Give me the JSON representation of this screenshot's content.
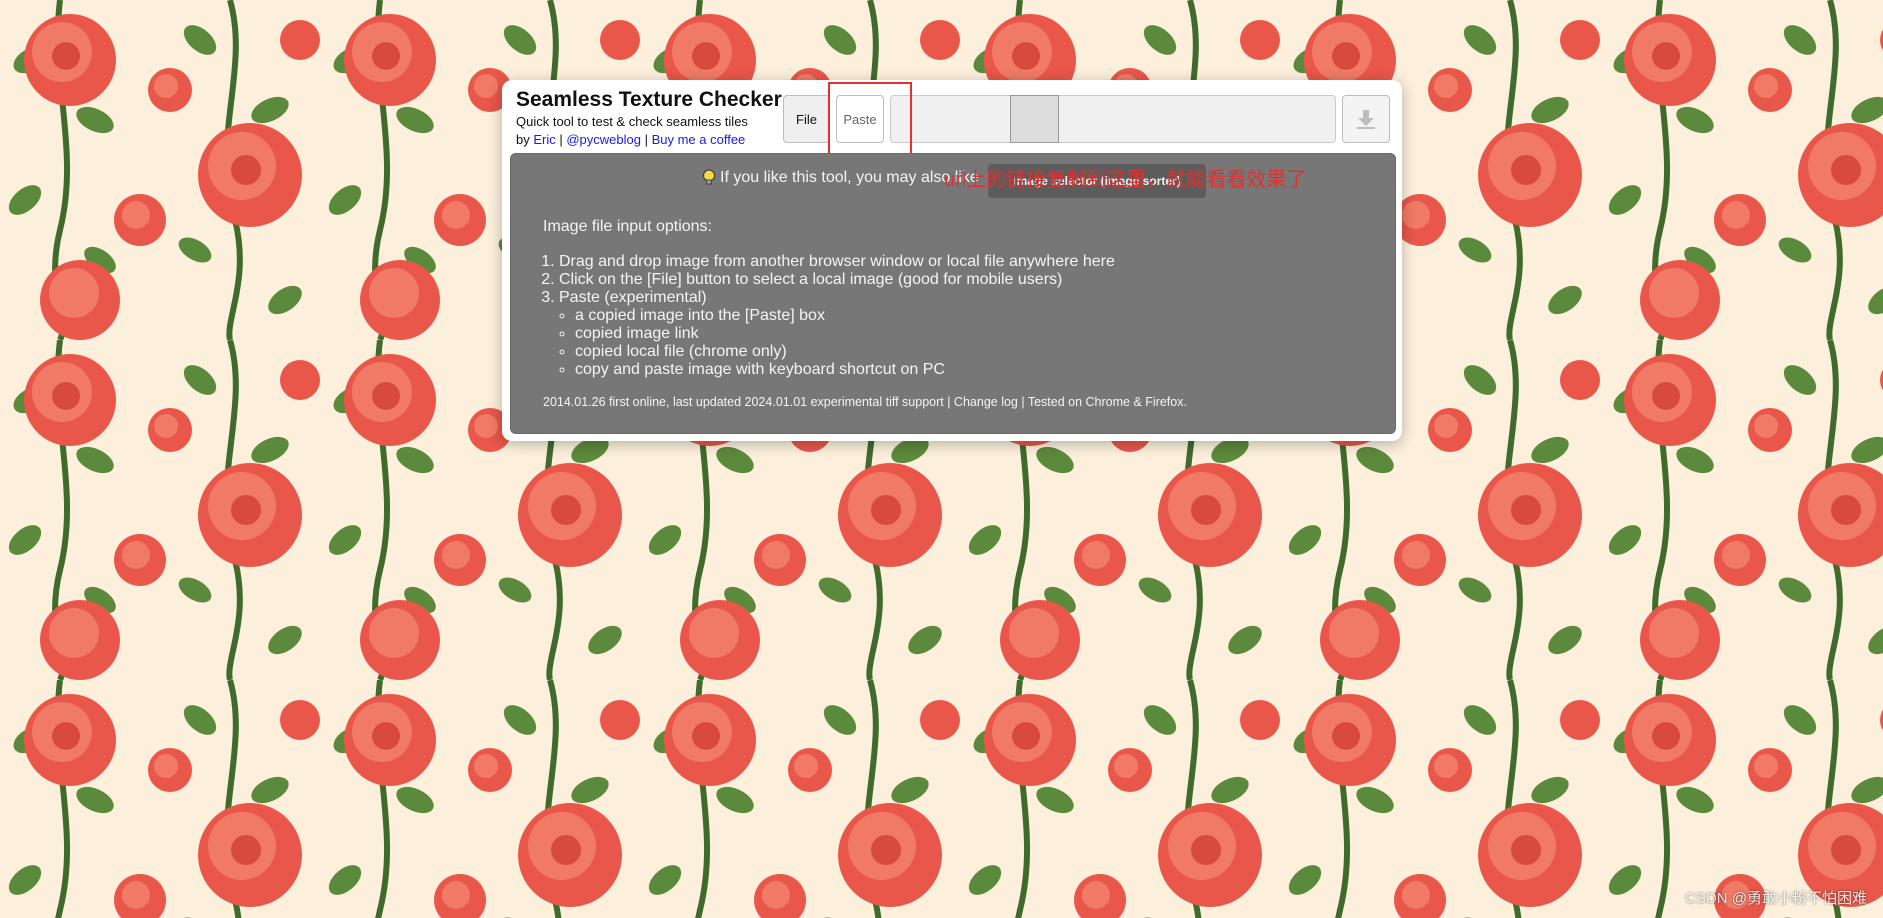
{
  "background": {
    "colors": {
      "cream": "#fcf0dc",
      "petal": "#e8574a",
      "petal_light": "#f07a66",
      "leaf": "#5c8a3c",
      "stem": "#3f6b2b"
    }
  },
  "header": {
    "title": "Seamless Texture Checker",
    "subtitle": "Quick tool to test & check seamless tiles",
    "by_prefix": "by ",
    "author": "Eric",
    "sep1": " | ",
    "handle": "@pycweblog",
    "sep2": " | ",
    "coffee": "Buy me a coffee"
  },
  "toolbar": {
    "file_label": "File",
    "paste_label": "Paste",
    "zoom_level": 0.3,
    "download_icon": "download-icon"
  },
  "info": {
    "tip_text": "If you like this tool, you may also like",
    "selector_button": "Image selector (image sorter)",
    "red_note": "url上的链接复制到这里，就能看看效果了",
    "options_title": "Image file input options:",
    "steps": [
      "Drag and drop image from another browser window or local file anywhere here",
      "Click on the [File] button to select a local image (good for mobile users)",
      "Paste (experimental)"
    ],
    "paste_subitems": [
      "a copied image into the [Paste] box",
      "copied image link",
      "copied local file (chrome only)",
      "copy and paste image with keyboard shortcut on PC"
    ],
    "footer": "2014.01.26 first online, last updated 2024.01.01 experimental tiff support | Change log | Tested on Chrome & Firefox."
  },
  "watermark": "CSDN @勇敢小粉不怕困难"
}
